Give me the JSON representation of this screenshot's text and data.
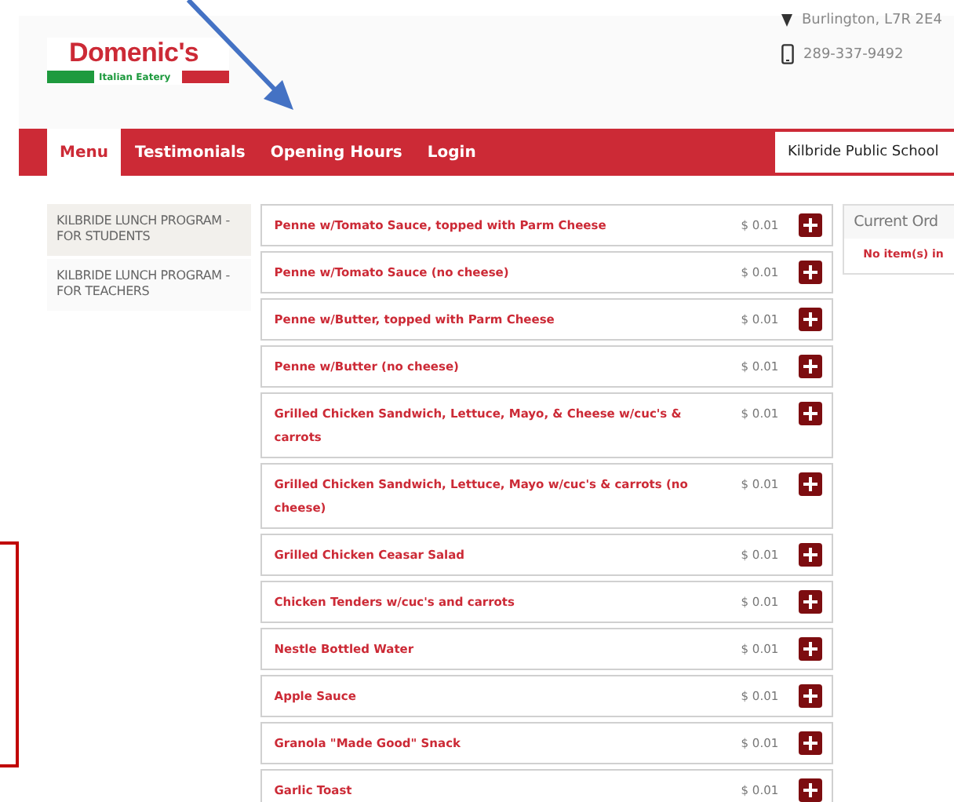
{
  "header": {
    "logo": {
      "name": "Domenic's",
      "tagline": "Italian Eatery"
    },
    "address_line": "Burlington, L7R 2E4",
    "phone": "289-337-9492"
  },
  "nav": {
    "tabs": [
      {
        "label": "Menu",
        "selected": true
      },
      {
        "label": "Testimonials",
        "selected": false
      },
      {
        "label": "Opening Hours",
        "selected": false
      },
      {
        "label": "Login",
        "selected": false
      }
    ],
    "school": "Kilbride Public School"
  },
  "sidebar": {
    "items": [
      {
        "label": "KILBRIDE LUNCH PROGRAM - FOR STUDENTS",
        "selected": true
      },
      {
        "label": "KILBRIDE LUNCH PROGRAM - FOR TEACHERS",
        "selected": false
      }
    ]
  },
  "menu_items": [
    {
      "name": "Penne w/Tomato Sauce, topped with Parm Cheese",
      "price": "$ 0.01"
    },
    {
      "name": "Penne w/Tomato Sauce (no cheese)",
      "price": "$ 0.01"
    },
    {
      "name": "Penne w/Butter, topped with Parm Cheese",
      "price": "$ 0.01"
    },
    {
      "name": "Penne w/Butter (no cheese)",
      "price": "$ 0.01"
    },
    {
      "name": "Grilled Chicken Sandwich, Lettuce, Mayo, & Cheese w/cuc's & carrots",
      "price": "$ 0.01"
    },
    {
      "name": "Grilled Chicken Sandwich, Lettuce, Mayo w/cuc's & carrots (no cheese)",
      "price": "$ 0.01"
    },
    {
      "name": "Grilled Chicken Ceasar Salad",
      "price": "$ 0.01"
    },
    {
      "name": "Chicken Tenders w/cuc's and carrots",
      "price": "$ 0.01"
    },
    {
      "name": "Nestle Bottled Water",
      "price": "$ 0.01"
    },
    {
      "name": "Apple Sauce",
      "price": "$ 0.01"
    },
    {
      "name": "Granola \"Made Good\" Snack",
      "price": "$ 0.01"
    },
    {
      "name": "Garlic Toast",
      "price": "$ 0.01"
    }
  ],
  "order": {
    "title": "Current Ord",
    "empty_message": "No item(s) in"
  }
}
